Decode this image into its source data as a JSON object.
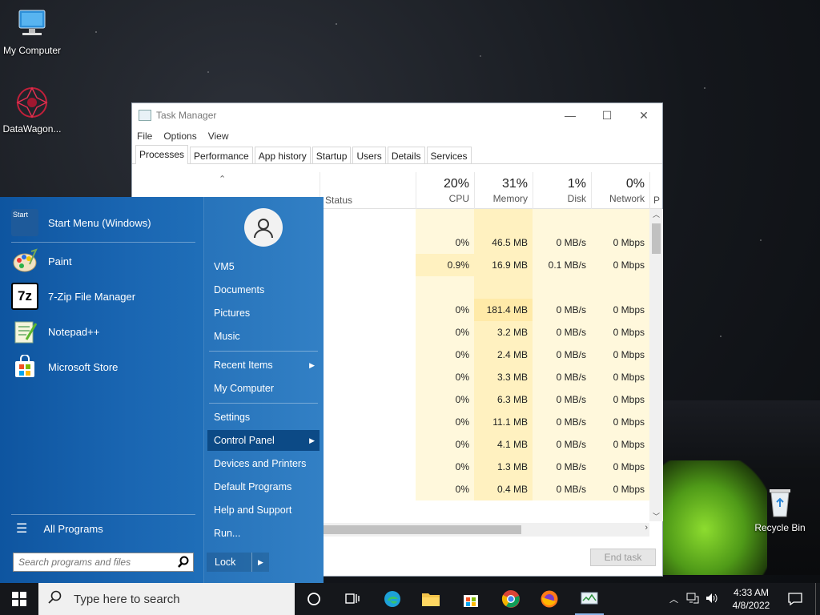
{
  "desktop": {
    "icons": [
      {
        "label": "My Computer"
      },
      {
        "label": "DataWagon..."
      },
      {
        "label": "Recycle Bin"
      }
    ]
  },
  "task_manager": {
    "title": "Task Manager",
    "menu": [
      "File",
      "Options",
      "View"
    ],
    "tabs": [
      "Processes",
      "Performance",
      "App history",
      "Startup",
      "Users",
      "Details",
      "Services"
    ],
    "active_tab": "Processes",
    "columns": {
      "status": "Status",
      "cpu": {
        "pct": "20%",
        "label": "CPU"
      },
      "memory": {
        "pct": "31%",
        "label": "Memory"
      },
      "disk": {
        "pct": "1%",
        "label": "Disk"
      },
      "network": {
        "pct": "0%",
        "label": "Network"
      },
      "partial": "P"
    },
    "rows": [
      {
        "cpu": "",
        "mem": "",
        "disk": "",
        "net": ""
      },
      {
        "cpu": "0%",
        "mem": "46.5 MB",
        "disk": "0 MB/s",
        "net": "0 Mbps"
      },
      {
        "cpu": "0.9%",
        "mem": "16.9 MB",
        "disk": "0.1 MB/s",
        "net": "0 Mbps"
      },
      {
        "cpu": "",
        "mem": "",
        "disk": "",
        "net": ""
      },
      {
        "cpu": "0%",
        "mem": "181.4 MB",
        "disk": "0 MB/s",
        "net": "0 Mbps"
      },
      {
        "cpu": "0%",
        "mem": "3.2 MB",
        "disk": "0 MB/s",
        "net": "0 Mbps"
      },
      {
        "cpu": "0%",
        "mem": "2.4 MB",
        "disk": "0 MB/s",
        "net": "0 Mbps"
      },
      {
        "cpu": "0%",
        "mem": "3.3 MB",
        "disk": "0 MB/s",
        "net": "0 Mbps"
      },
      {
        "cpu": "0%",
        "mem": "6.3 MB",
        "disk": "0 MB/s",
        "net": "0 Mbps"
      },
      {
        "cpu": "0%",
        "mem": "11.1 MB",
        "disk": "0 MB/s",
        "net": "0 Mbps"
      },
      {
        "cpu": "0%",
        "mem": "4.1 MB",
        "disk": "0 MB/s",
        "net": "0 Mbps"
      },
      {
        "cpu": "0%",
        "mem": "1.3 MB",
        "disk": "0 MB/s",
        "net": "0 Mbps"
      },
      {
        "cpu": "0%",
        "mem": "0.4 MB",
        "disk": "0 MB/s",
        "net": "0 Mbps"
      }
    ],
    "end_task": "End task"
  },
  "start_menu": {
    "pinned": [
      {
        "label": "Start Menu (Windows)",
        "icon": "start-menu-icon"
      },
      {
        "label": "Paint",
        "icon": "paint-icon"
      },
      {
        "label": "7-Zip File Manager",
        "icon": "7zip-icon"
      },
      {
        "label": "Notepad++",
        "icon": "notepadpp-icon"
      },
      {
        "label": "Microsoft Store",
        "icon": "store-icon"
      }
    ],
    "start_icon_text": "Start",
    "seven_zip_text": "7z",
    "all_programs": "All Programs",
    "search_placeholder": "Search programs and files",
    "right": {
      "user": "VM5",
      "items1": [
        "Documents",
        "Pictures",
        "Music"
      ],
      "items2": [
        "Recent Items",
        "My Computer"
      ],
      "items3": [
        "Settings",
        "Control Panel",
        "Devices and Printers",
        "Default Programs",
        "Help and Support",
        "Run..."
      ]
    },
    "lock": "Lock"
  },
  "taskbar": {
    "search_text": "Type here to search",
    "time": "4:33 AM",
    "date": "4/8/2022"
  }
}
